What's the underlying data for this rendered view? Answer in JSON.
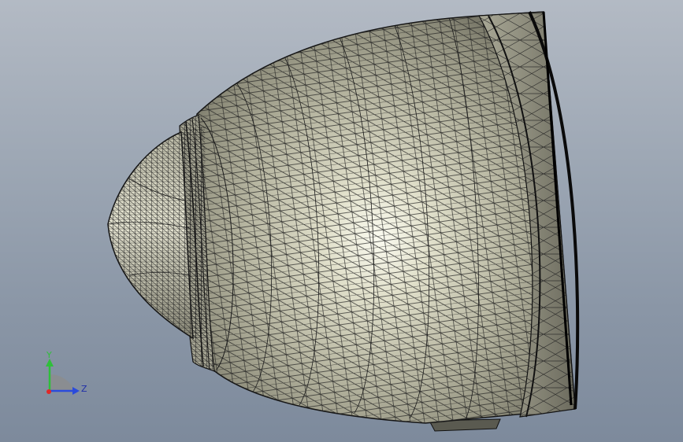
{
  "viewport": {
    "background_top": "#b3bac4",
    "background_bottom": "#7d8a9c"
  },
  "model": {
    "display_mode": "shaded-with-mesh-edges",
    "surface_color": "#c9c8b4",
    "highlight_color": "#f4f4e8",
    "edge_color": "#1a1a1a"
  },
  "triad": {
    "y_label": "Y",
    "z_label": "Z",
    "y_color": "#2fbf3a",
    "z_color": "#2a4bdc",
    "x_color": "#e02828"
  }
}
